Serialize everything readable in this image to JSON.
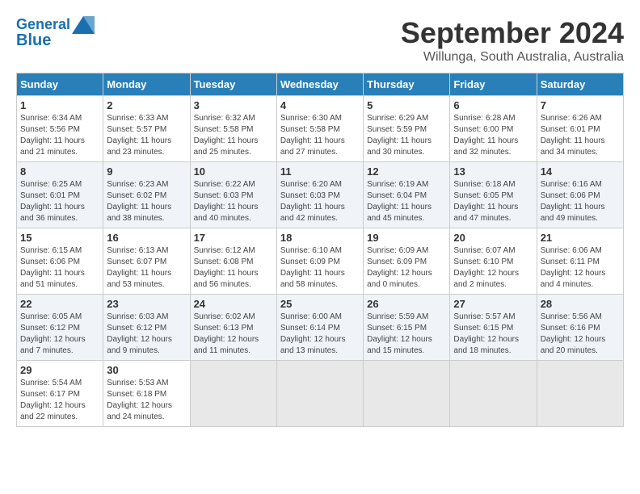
{
  "header": {
    "logo_line1": "General",
    "logo_line2": "Blue",
    "title": "September 2024",
    "subtitle": "Willunga, South Australia, Australia"
  },
  "calendar": {
    "days_of_week": [
      "Sunday",
      "Monday",
      "Tuesday",
      "Wednesday",
      "Thursday",
      "Friday",
      "Saturday"
    ],
    "weeks": [
      [
        {
          "day": "",
          "empty": true
        },
        {
          "day": "",
          "empty": true
        },
        {
          "day": "",
          "empty": true
        },
        {
          "day": "",
          "empty": true
        },
        {
          "day": "",
          "empty": true
        },
        {
          "day": "",
          "empty": true
        },
        {
          "day": "",
          "empty": true
        }
      ],
      [
        {
          "day": "1",
          "sunrise": "6:34 AM",
          "sunset": "5:56 PM",
          "daylight": "11 hours and 21 minutes."
        },
        {
          "day": "2",
          "sunrise": "6:33 AM",
          "sunset": "5:57 PM",
          "daylight": "11 hours and 23 minutes."
        },
        {
          "day": "3",
          "sunrise": "6:32 AM",
          "sunset": "5:58 PM",
          "daylight": "11 hours and 25 minutes."
        },
        {
          "day": "4",
          "sunrise": "6:30 AM",
          "sunset": "5:58 PM",
          "daylight": "11 hours and 27 minutes."
        },
        {
          "day": "5",
          "sunrise": "6:29 AM",
          "sunset": "5:59 PM",
          "daylight": "11 hours and 30 minutes."
        },
        {
          "day": "6",
          "sunrise": "6:28 AM",
          "sunset": "6:00 PM",
          "daylight": "11 hours and 32 minutes."
        },
        {
          "day": "7",
          "sunrise": "6:26 AM",
          "sunset": "6:01 PM",
          "daylight": "11 hours and 34 minutes."
        }
      ],
      [
        {
          "day": "8",
          "sunrise": "6:25 AM",
          "sunset": "6:01 PM",
          "daylight": "11 hours and 36 minutes."
        },
        {
          "day": "9",
          "sunrise": "6:23 AM",
          "sunset": "6:02 PM",
          "daylight": "11 hours and 38 minutes."
        },
        {
          "day": "10",
          "sunrise": "6:22 AM",
          "sunset": "6:03 PM",
          "daylight": "11 hours and 40 minutes."
        },
        {
          "day": "11",
          "sunrise": "6:20 AM",
          "sunset": "6:03 PM",
          "daylight": "11 hours and 42 minutes."
        },
        {
          "day": "12",
          "sunrise": "6:19 AM",
          "sunset": "6:04 PM",
          "daylight": "11 hours and 45 minutes."
        },
        {
          "day": "13",
          "sunrise": "6:18 AM",
          "sunset": "6:05 PM",
          "daylight": "11 hours and 47 minutes."
        },
        {
          "day": "14",
          "sunrise": "6:16 AM",
          "sunset": "6:06 PM",
          "daylight": "11 hours and 49 minutes."
        }
      ],
      [
        {
          "day": "15",
          "sunrise": "6:15 AM",
          "sunset": "6:06 PM",
          "daylight": "11 hours and 51 minutes."
        },
        {
          "day": "16",
          "sunrise": "6:13 AM",
          "sunset": "6:07 PM",
          "daylight": "11 hours and 53 minutes."
        },
        {
          "day": "17",
          "sunrise": "6:12 AM",
          "sunset": "6:08 PM",
          "daylight": "11 hours and 56 minutes."
        },
        {
          "day": "18",
          "sunrise": "6:10 AM",
          "sunset": "6:09 PM",
          "daylight": "11 hours and 58 minutes."
        },
        {
          "day": "19",
          "sunrise": "6:09 AM",
          "sunset": "6:09 PM",
          "daylight": "12 hours and 0 minutes."
        },
        {
          "day": "20",
          "sunrise": "6:07 AM",
          "sunset": "6:10 PM",
          "daylight": "12 hours and 2 minutes."
        },
        {
          "day": "21",
          "sunrise": "6:06 AM",
          "sunset": "6:11 PM",
          "daylight": "12 hours and 4 minutes."
        }
      ],
      [
        {
          "day": "22",
          "sunrise": "6:05 AM",
          "sunset": "6:12 PM",
          "daylight": "12 hours and 7 minutes."
        },
        {
          "day": "23",
          "sunrise": "6:03 AM",
          "sunset": "6:12 PM",
          "daylight": "12 hours and 9 minutes."
        },
        {
          "day": "24",
          "sunrise": "6:02 AM",
          "sunset": "6:13 PM",
          "daylight": "12 hours and 11 minutes."
        },
        {
          "day": "25",
          "sunrise": "6:00 AM",
          "sunset": "6:14 PM",
          "daylight": "12 hours and 13 minutes."
        },
        {
          "day": "26",
          "sunrise": "5:59 AM",
          "sunset": "6:15 PM",
          "daylight": "12 hours and 15 minutes."
        },
        {
          "day": "27",
          "sunrise": "5:57 AM",
          "sunset": "6:15 PM",
          "daylight": "12 hours and 18 minutes."
        },
        {
          "day": "28",
          "sunrise": "5:56 AM",
          "sunset": "6:16 PM",
          "daylight": "12 hours and 20 minutes."
        }
      ],
      [
        {
          "day": "29",
          "sunrise": "5:54 AM",
          "sunset": "6:17 PM",
          "daylight": "12 hours and 22 minutes."
        },
        {
          "day": "30",
          "sunrise": "5:53 AM",
          "sunset": "6:18 PM",
          "daylight": "12 hours and 24 minutes."
        },
        {
          "day": "",
          "empty": true
        },
        {
          "day": "",
          "empty": true
        },
        {
          "day": "",
          "empty": true
        },
        {
          "day": "",
          "empty": true
        },
        {
          "day": "",
          "empty": true
        }
      ]
    ]
  },
  "labels": {
    "sunrise_prefix": "Sunrise: ",
    "sunset_prefix": "Sunset: ",
    "daylight_prefix": "Daylight: "
  }
}
